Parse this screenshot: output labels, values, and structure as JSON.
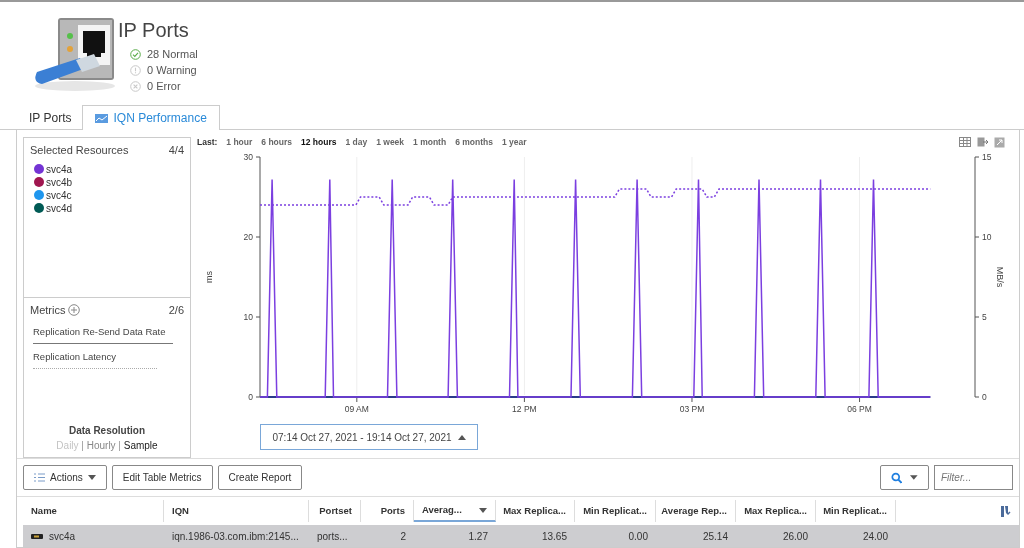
{
  "header": {
    "title": "IP Ports",
    "statuses": [
      {
        "kind": "normal",
        "label": "28 Normal"
      },
      {
        "kind": "warning",
        "label": "0 Warning"
      },
      {
        "kind": "error",
        "label": "0 Error"
      }
    ]
  },
  "tabs": [
    {
      "label": "IP Ports",
      "selected": false,
      "kind": "plain"
    },
    {
      "label": "IQN Performance",
      "selected": true,
      "kind": "chart"
    }
  ],
  "resources": {
    "title": "Selected Resources",
    "count": "4/4",
    "items": [
      {
        "name": "svc4a",
        "color": "#7434d4"
      },
      {
        "name": "svc4b",
        "color": "#a0164f"
      },
      {
        "name": "svc4c",
        "color": "#1f96ee"
      },
      {
        "name": "svc4d",
        "color": "#005a55"
      }
    ]
  },
  "metrics": {
    "title": "Metrics",
    "count": "2/6",
    "items": [
      {
        "kind": "solid"
      },
      {
        "kind": "dotted"
      }
    ]
  },
  "data_resolution": {
    "title": "Data Resolution",
    "separator": "|",
    "options": [
      {
        "label": "Daily",
        "selected": false,
        "disabled": true
      },
      {
        "label": "Hourly",
        "selected": false,
        "disabled": false
      },
      {
        "label": "Sample",
        "selected": true,
        "disabled": false
      }
    ]
  },
  "time_ranges": {
    "label": "Last:",
    "options": [
      {
        "label": "1 hour",
        "selected": false
      },
      {
        "label": "6 hours",
        "selected": false
      },
      {
        "label": "12 hours",
        "selected": true
      },
      {
        "label": "1 day",
        "selected": false
      },
      {
        "label": "1 week",
        "selected": false
      },
      {
        "label": "1 month",
        "selected": false
      },
      {
        "label": "6 months",
        "selected": false
      },
      {
        "label": "1 year",
        "selected": false
      }
    ]
  },
  "chart": {
    "chart_data": {
      "type": "line",
      "ylabel": "ms",
      "y2label": "MB/s",
      "x": [
        "2021-10-27T07:16",
        "2021-10-27T07:24",
        "2021-10-27T07:29",
        "2021-10-27T07:34",
        "2021-10-27T08:26",
        "2021-10-27T08:31",
        "2021-10-27T08:35",
        "2021-10-27T08:59",
        "2021-10-27T09:04",
        "2021-10-27T09:24",
        "2021-10-27T09:29",
        "2021-10-27T09:33",
        "2021-10-27T09:38",
        "2021-10-27T09:43",
        "2021-10-27T09:55",
        "2021-10-27T10:00",
        "2021-10-27T10:18",
        "2021-10-27T10:23",
        "2021-10-27T10:38",
        "2021-10-27T10:43",
        "2021-10-27T10:48",
        "2021-10-27T11:44",
        "2021-10-27T11:49",
        "2021-10-27T11:53",
        "2021-10-27T12:50",
        "2021-10-27T12:55",
        "2021-10-27T13:00",
        "2021-10-27T13:37",
        "2021-10-27T13:42",
        "2021-10-27T13:56",
        "2021-10-27T14:01",
        "2021-10-27T14:06",
        "2021-10-27T14:11",
        "2021-10-27T14:16",
        "2021-10-27T14:38",
        "2021-10-27T14:43",
        "2021-10-27T15:02",
        "2021-10-27T15:07",
        "2021-10-27T15:11",
        "2021-10-27T15:16",
        "2021-10-27T15:24",
        "2021-10-27T15:29",
        "2021-10-27T16:07",
        "2021-10-27T16:12",
        "2021-10-27T16:17",
        "2021-10-27T17:13",
        "2021-10-27T17:18",
        "2021-10-27T17:23",
        "2021-10-27T18:10",
        "2021-10-27T18:15",
        "2021-10-27T18:20",
        "2021-10-27T19:16"
      ],
      "series": [
        {
          "name": "Replication Re-Send Data Rate",
          "color": "#7b3fe0",
          "axis": "y2",
          "line_style": "solid",
          "values": [
            0,
            0,
            13.6,
            0,
            0,
            13.6,
            0,
            0,
            0,
            0,
            0,
            0,
            13.6,
            0,
            0,
            0,
            0,
            0,
            0,
            13.6,
            0,
            0,
            13.6,
            0,
            0,
            13.6,
            0,
            0,
            0,
            0,
            13.6,
            0,
            0,
            0,
            0,
            0,
            0,
            13.6,
            0,
            0,
            0,
            0,
            0,
            13.6,
            0,
            0,
            13.6,
            0,
            0,
            13.6,
            0,
            0
          ]
        },
        {
          "name": "Replication Latency",
          "color": "#7b3fe0",
          "line_style": "dotted",
          "values": [
            24,
            24,
            24,
            24,
            24,
            24,
            24,
            24,
            25,
            25,
            24,
            24,
            24,
            24,
            24,
            25,
            25,
            24,
            24,
            25,
            25,
            25,
            25,
            25,
            25,
            25,
            25,
            25,
            26,
            26,
            26,
            26,
            26,
            25,
            25,
            26,
            26,
            26,
            26,
            25,
            25,
            26,
            26,
            26,
            26,
            26,
            26,
            26,
            26,
            26,
            26,
            26
          ]
        }
      ],
      "grid": true,
      "xlim": [
        "2021-10-27T07:16",
        "2021-10-27T20:04"
      ],
      "ylim": [
        0,
        30
      ],
      "y2lim": [
        0,
        15
      ],
      "xticks": [
        {
          "value": "2021-10-27T09:00",
          "label": "09 AM"
        },
        {
          "value": "2021-10-27T12:00",
          "label": "12 PM"
        },
        {
          "value": "2021-10-27T15:00",
          "label": "03 PM"
        },
        {
          "value": "2021-10-27T18:00",
          "label": "06 PM"
        }
      ],
      "yticks": [
        0,
        10,
        20,
        30
      ],
      "y2ticks": [
        0,
        5,
        10,
        15
      ]
    }
  },
  "date_range": "07:14 Oct 27, 2021 - 19:14 Oct 27, 2021",
  "table": {
    "actions": "Actions",
    "buttons": [
      "Edit Table Metrics",
      "Create Report"
    ],
    "filter_placeholder": "Filter...",
    "columns": [
      {
        "label": "Name",
        "sorted": false
      },
      {
        "label": "IQN",
        "sorted": false
      },
      {
        "label": "Portset",
        "sorted": false
      },
      {
        "label": "Ports",
        "sorted": false
      },
      {
        "label": "Averag...",
        "sorted": true
      },
      {
        "label": "Max Replica...",
        "sorted": false
      },
      {
        "label": "Min Replicat...",
        "sorted": false
      },
      {
        "label": "Average Rep...",
        "sorted": false
      },
      {
        "label": "Max Replica...",
        "sorted": false
      },
      {
        "label": "Min Replicat...",
        "sorted": false
      }
    ],
    "rows": [
      {
        "selected": true,
        "cells": [
          "svc4a",
          "iqn.1986-03.com.ibm:2145...",
          "ports...",
          "2",
          "1.27",
          "13.65",
          "0.00",
          "25.14",
          "26.00",
          "24.00"
        ]
      }
    ]
  }
}
